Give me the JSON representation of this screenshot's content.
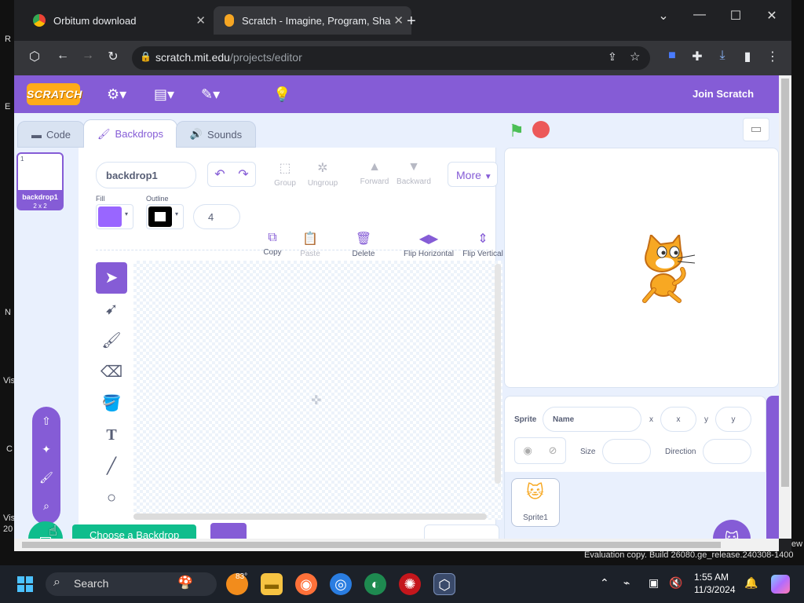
{
  "desktop": {
    "side_labels": [
      "R",
      "E",
      "N",
      "Vis",
      "C",
      "Vis",
      "20"
    ],
    "right_label": "ew",
    "watermark": "Evaluation copy. Build 26080.ge_release.240308-1400"
  },
  "browser": {
    "tabs": [
      {
        "title": "Orbitum download",
        "close": "✕"
      },
      {
        "title": "Scratch - Imagine, Program, Sha",
        "close": "✕"
      }
    ],
    "new_tab": "+",
    "url_host": "scratch.mit.edu",
    "url_path": "/projects/editor"
  },
  "scratch": {
    "logo": "SCRATCH",
    "join": "Join Scratch",
    "tabs": {
      "code": "Code",
      "backdrops": "Backdrops",
      "sounds": "Sounds"
    },
    "backdrop": {
      "index": "1",
      "name": "backdrop1",
      "size": "2 x 2"
    },
    "paint": {
      "name_value": "backdrop1",
      "group": "Group",
      "ungroup": "Ungroup",
      "forward": "Forward",
      "backward": "Backward",
      "more": "More",
      "fill_label": "Fill",
      "outline_label": "Outline",
      "outline_width": "4",
      "copy": "Copy",
      "paste": "Paste",
      "delete": "Delete",
      "flip_h": "Flip Horizontal",
      "flip_v": "Flip Vertical",
      "fill_color": "#9966ff"
    },
    "choose_backdrop": "Choose a Backdrop",
    "sprite": {
      "label": "Sprite",
      "name_placeholder": "Name",
      "x_label": "x",
      "x_placeholder": "x",
      "y_label": "y",
      "y_placeholder": "y",
      "size_label": "Size",
      "direction_label": "Direction",
      "thumb_name": "Sprite1"
    }
  },
  "taskbar": {
    "search": "Search",
    "weather": "83°",
    "time": "1:55 AM",
    "date": "11/3/2024"
  }
}
